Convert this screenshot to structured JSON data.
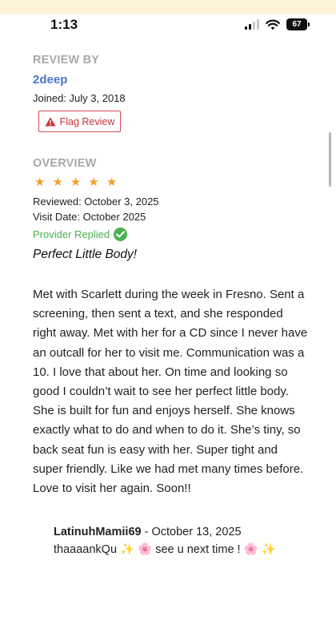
{
  "status_bar": {
    "time": "1:13",
    "battery": "67"
  },
  "review_by": {
    "label": "REVIEW BY",
    "username": "2deep",
    "joined": "Joined: July 3, 2018",
    "flag_button": "Flag Review"
  },
  "overview": {
    "label": "OVERVIEW",
    "rating": 5,
    "stars": [
      "★",
      "★",
      "★",
      "★",
      "★"
    ],
    "reviewed": "Reviewed: October 3, 2025",
    "visit_date": "Visit Date: October 2025",
    "provider_replied": "Provider Replied",
    "title": "Perfect Little Body!"
  },
  "review_body_lines": [
    "Met with Scarlett during the week in Fresno. Sent a",
    "screening, then sent a text, and she responded",
    "right away. Met with her for a CD since I never have",
    "an outcall for her to visit me. Communication was a",
    "10. I love that about her. On time and looking so",
    "good I couldn’t wait to see her perfect little body.",
    "She is built for fun and enjoys herself. She knows",
    "exactly what to do and when to do it. She’s tiny, so",
    "back seat fun is easy with her. Super tight and",
    "super friendly. Like we had met many times before.",
    "Love to visit her again. Soon!!"
  ],
  "reply": {
    "author": "LatinuhMamii69",
    "date": " - October 13, 2025",
    "text": "thaaaankQu  ✨ 🌸 see u next time ! 🌸 ✨"
  },
  "colors": {
    "accent_link": "#4a74c9",
    "flag_red": "#c8323f",
    "star_orange": "#f0a02a",
    "replied_green": "#4cb050",
    "section_gray": "#a8a8a8",
    "top_band": "#fdf4d8"
  }
}
